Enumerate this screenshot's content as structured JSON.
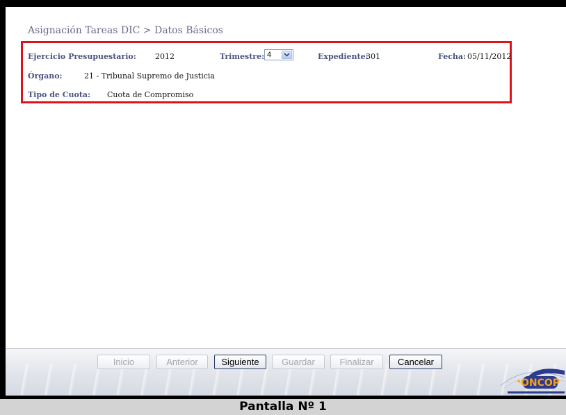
{
  "header": {
    "title": "Asignación Tareas DIC > Datos Básicos"
  },
  "info": {
    "ejercicio_label": "Ejercicio Presupuestario:",
    "ejercicio_value": "2012",
    "trimestre_label": "Trimestre:",
    "trimestre_value": "4",
    "expediente_label": "Expediente:",
    "expediente_value": "301",
    "fecha_label": "Fecha:",
    "fecha_value": "05/11/2012",
    "organo_label": "Órgano:",
    "organo_value": "21 - Tribunal Supremo de Justicia",
    "tipo_cuota_label": "Tipo de Cuota:",
    "tipo_cuota_value": "Cuota de Compromiso"
  },
  "toolbar": {
    "inicio": "Inicio",
    "anterior": "Anterior",
    "siguiente": "Siguiente",
    "guardar": "Guardar",
    "finalizar": "Finalizar",
    "cancelar": "Cancelar"
  },
  "logo": {
    "text": "ONCOP"
  },
  "caption": "Pantalla Nº 1",
  "colors": {
    "highlight_border": "#e0111b",
    "label": "#4a5383",
    "title": "#6b6c8e",
    "logo_orange": "#f5a21a",
    "logo_blue": "#2d3b8f"
  }
}
